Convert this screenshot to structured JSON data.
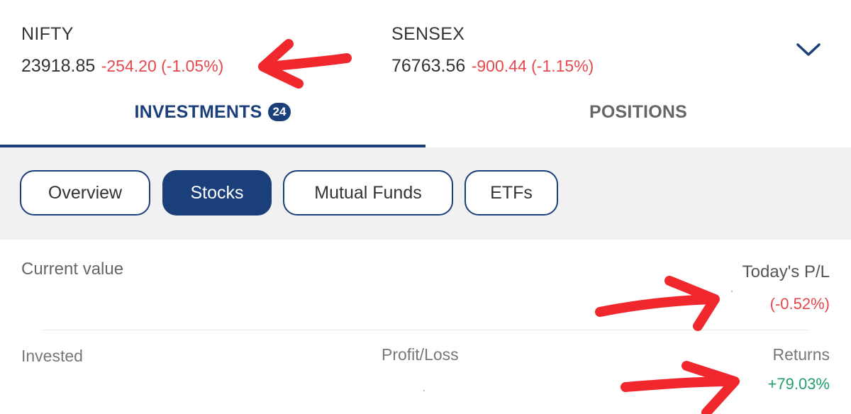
{
  "indices": [
    {
      "name": "NIFTY",
      "value": "23918.85",
      "change": "-254.20 (-1.05%)"
    },
    {
      "name": "SENSEX",
      "value": "76763.56",
      "change": "-900.44 (-1.15%)"
    }
  ],
  "expand_icon": "chevron-down-icon",
  "tabs": {
    "investments": {
      "label": "INVESTMENTS",
      "badge": "24",
      "active": true
    },
    "positions": {
      "label": "POSITIONS",
      "active": false
    }
  },
  "filters": [
    {
      "label": "Overview",
      "active": false
    },
    {
      "label": "Stocks",
      "active": true
    },
    {
      "label": "Mutual Funds",
      "active": false
    },
    {
      "label": "ETFs",
      "active": false
    }
  ],
  "summary": {
    "current_value_label": "Current value",
    "todays_pl_label": "Today's P/L",
    "todays_pl_pct": "(-0.52%)",
    "invested_label": "Invested",
    "profit_loss_label": "Profit/Loss",
    "returns_label": "Returns",
    "returns_pct": "+79.03%"
  },
  "colors": {
    "brand": "#1b3f7a",
    "negative": "#e5484d",
    "positive": "#22a06b",
    "annotation": "#f0282d"
  }
}
